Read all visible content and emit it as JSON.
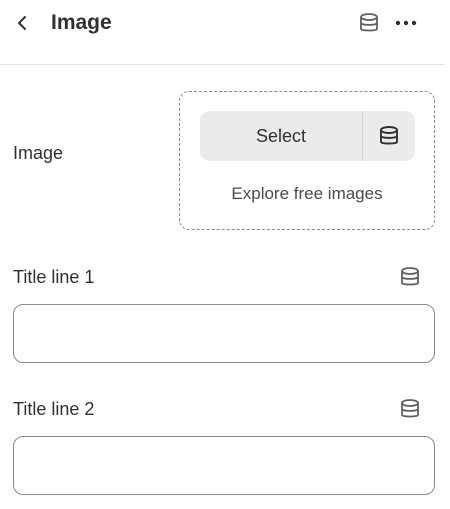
{
  "header": {
    "title": "Image",
    "back_icon": "chevron-left-icon",
    "source_icon": "database-icon",
    "more_icon": "more-horizontal-icon"
  },
  "image_field": {
    "label": "Image",
    "select_label": "Select",
    "select_source_icon": "database-icon",
    "explore_label": "Explore free images"
  },
  "title_line_1": {
    "label": "Title line 1",
    "value": "",
    "source_icon": "database-icon"
  },
  "title_line_2": {
    "label": "Title line 2",
    "value": "",
    "source_icon": "database-icon"
  },
  "colors": {
    "text": "#303030",
    "border": "#8a8a8a",
    "button_bg": "#ebebeb",
    "icon": "#616161"
  }
}
